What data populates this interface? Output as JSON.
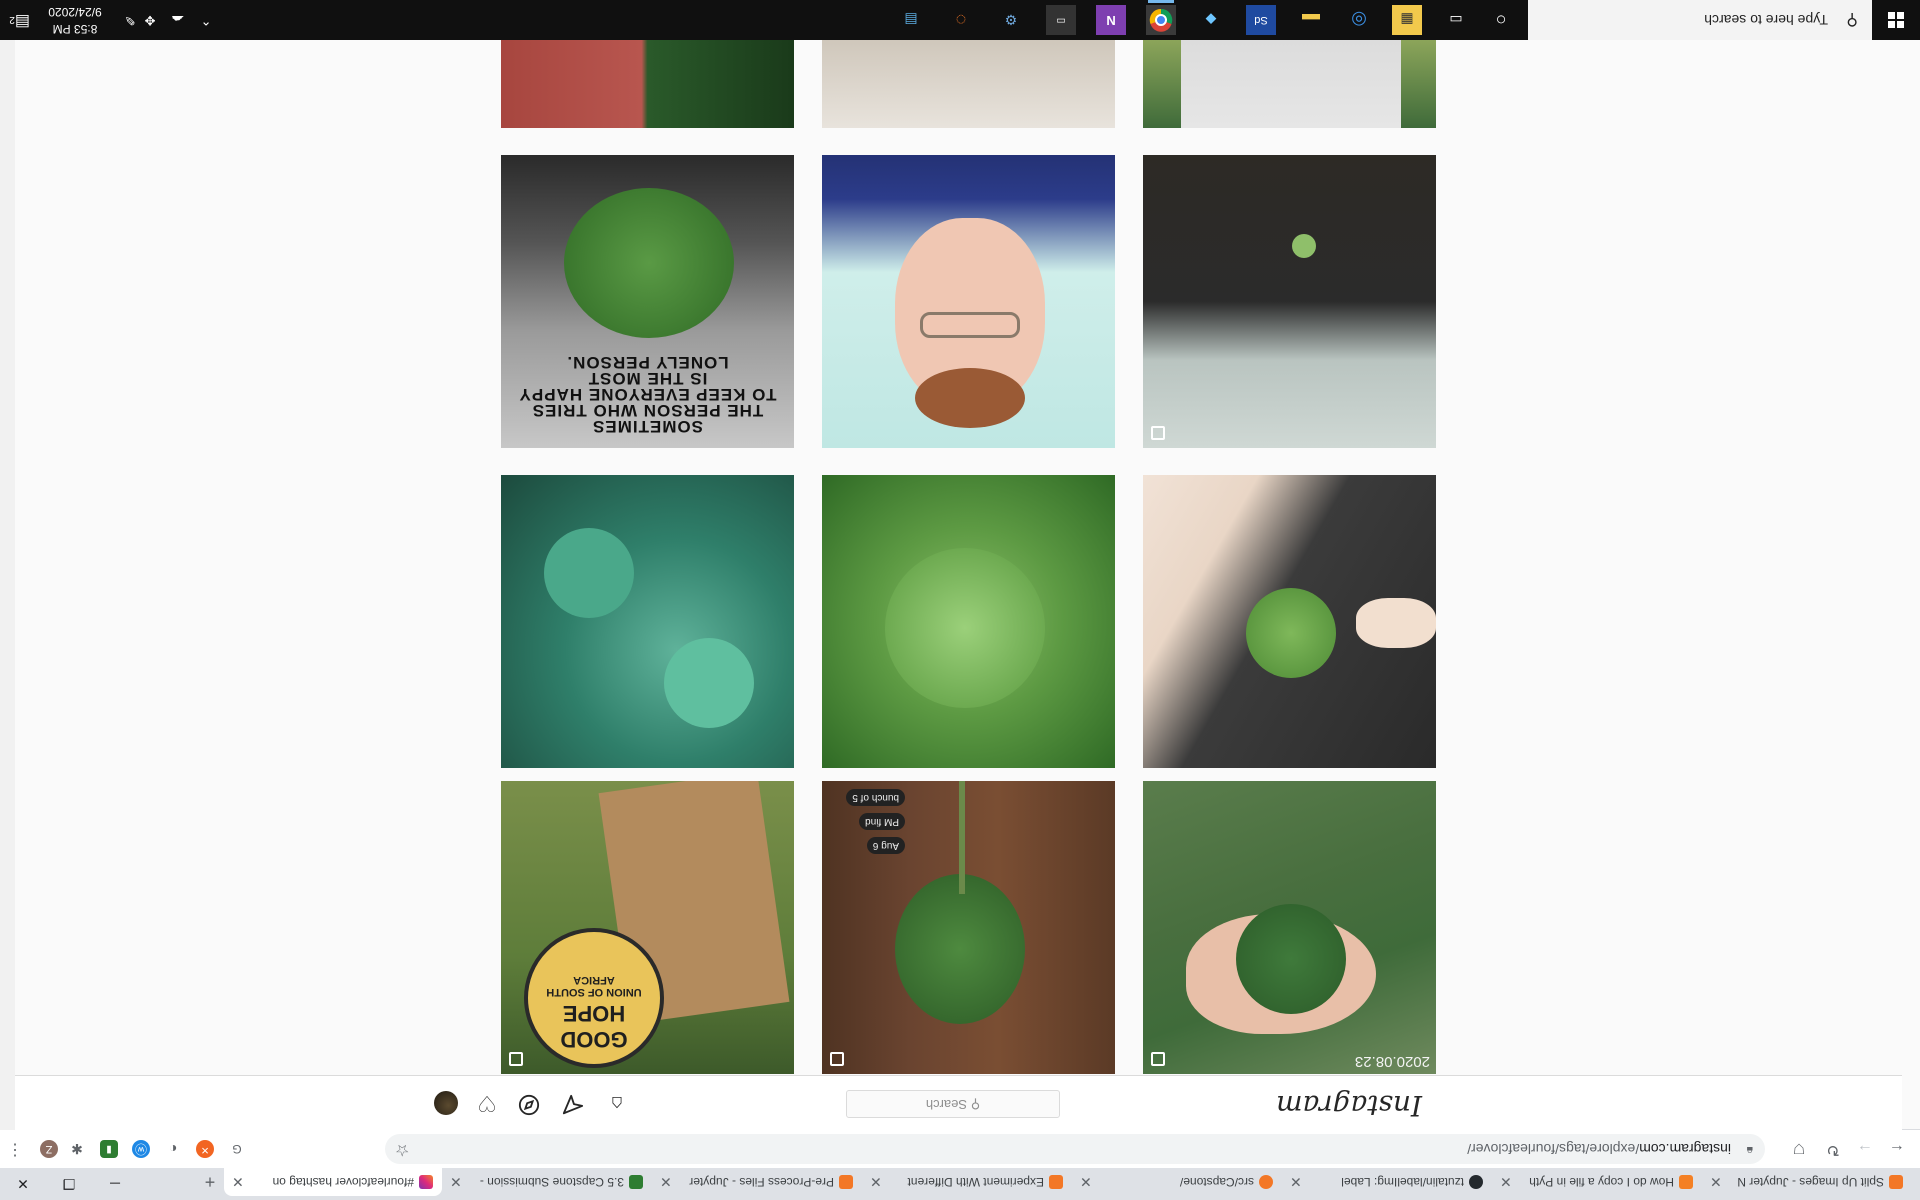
{
  "browser": {
    "tabs": [
      {
        "title": "Split Up Images - Jupyter N",
        "icon_color": "#f37726",
        "active": false
      },
      {
        "title": "How do I copy a file in Pyth",
        "icon_color": "#f48024",
        "active": false
      },
      {
        "title": "tzutalin/labelImg: Label",
        "icon_color": "#24292e",
        "active": false
      },
      {
        "title": "src/Capstone/",
        "icon_color": "#f37726",
        "active": false
      },
      {
        "title": "Experiment With Different",
        "icon_color": "#f37726",
        "active": false
      },
      {
        "title": "Pre-Process Files - Jupyter",
        "icon_color": "#f37726",
        "active": false
      },
      {
        "title": "3.5 Capstone Submission -",
        "icon_color": "#2e7d32",
        "active": false
      },
      {
        "title": "#fourleafclover hashtag on",
        "icon_color": "#c13584",
        "active": true
      }
    ],
    "new_tab": "+",
    "window_controls": {
      "minimize": "─",
      "restore": "❐",
      "close": "✕"
    }
  },
  "toolbar": {
    "url_domain": "instagram.com",
    "url_path": "/explore/tags/fourleafclover/",
    "back": "←",
    "forward": "→",
    "reload": "↻",
    "extensions": [
      {
        "label": "G",
        "color": "#5f6368"
      },
      {
        "label": "✕",
        "color": "#f26522"
      },
      {
        "label": "◐",
        "color": "#5f6368"
      },
      {
        "label": "ⓦ",
        "color": "#1e88e5"
      },
      {
        "label": "▮",
        "color": "#2e7d32"
      },
      {
        "label": "✱",
        "color": "#5f6368"
      }
    ],
    "profile_initial": "Z",
    "menu": "⋮"
  },
  "instagram": {
    "logo": "Instagram",
    "search_placeholder": "Search",
    "search_icon": "⚲"
  },
  "posts": [
    {
      "row": 0,
      "col": 0,
      "desc": "hand holding four leaf clover",
      "date_stamp": "2020.08.23",
      "multi": true
    },
    {
      "row": 0,
      "col": 1,
      "desc": "clover stem on wooden table",
      "tags": [
        "Aug 6",
        "PM find",
        "bunch of 5"
      ],
      "multi": true
    },
    {
      "row": 0,
      "col": 2,
      "desc": "Good Hope crate with clover",
      "logo_top": "GOOD HOPE",
      "logo_sub": "UNION OF SOUTH AFRICA",
      "multi": true
    },
    {
      "row": 1,
      "col": 0,
      "desc": "fingers holding clover over leather",
      "multi": false
    },
    {
      "row": 1,
      "col": 1,
      "desc": "field of clover",
      "multi": false
    },
    {
      "row": 1,
      "col": 2,
      "desc": "teal clover patch",
      "multi": false
    },
    {
      "row": 2,
      "col": 0,
      "desc": "clover sprout in pot",
      "multi": true
    },
    {
      "row": 2,
      "col": 1,
      "desc": "cartoon portrait with clover",
      "multi": false
    },
    {
      "row": 2,
      "col": 2,
      "desc": "quote with clover leaf",
      "quote": [
        "SOMETIMES",
        "THE PERSON WHO TRIES",
        "TO KEEP EVERYONE HAPPY",
        "IS THE MOST",
        "LONELY PERSON."
      ],
      "multi": false
    }
  ],
  "taskbar": {
    "search_placeholder": "Type here to search",
    "time": "8:53 PM",
    "date": "9/24/2020",
    "notification_count": "2"
  }
}
